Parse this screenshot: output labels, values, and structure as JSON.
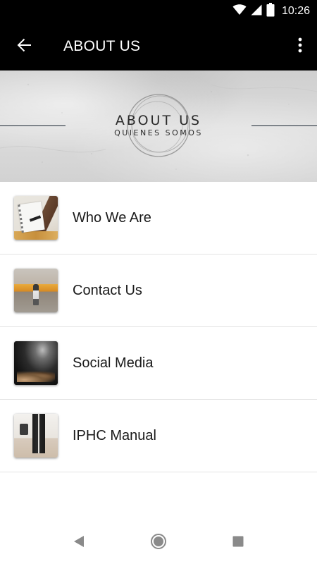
{
  "status_bar": {
    "time": "10:26",
    "icons": [
      "wifi-icon",
      "cell-signal-icon",
      "battery-icon"
    ]
  },
  "app_bar": {
    "title": "ABOUT US",
    "back_icon": "arrow-left-icon",
    "menu_icon": "overflow-menu-icon",
    "background": "#000000",
    "foreground": "#ffffff"
  },
  "banner": {
    "title": "ABOUT US",
    "subtitle": "QUIENES SOMOS",
    "line_color": "#1b2733"
  },
  "menu": {
    "items": [
      {
        "label": "Who We Are",
        "thumbnail": "notebook-writing-photo"
      },
      {
        "label": "Contact Us",
        "thumbnail": "train-station-photo"
      },
      {
        "label": "Social Media",
        "thumbnail": "worship-hands-photo"
      },
      {
        "label": "IPHC Manual",
        "thumbnail": "walking-legs-photo"
      }
    ]
  },
  "nav_bar": {
    "buttons": [
      "back-triangle-icon",
      "home-circle-icon",
      "recents-square-icon"
    ]
  }
}
